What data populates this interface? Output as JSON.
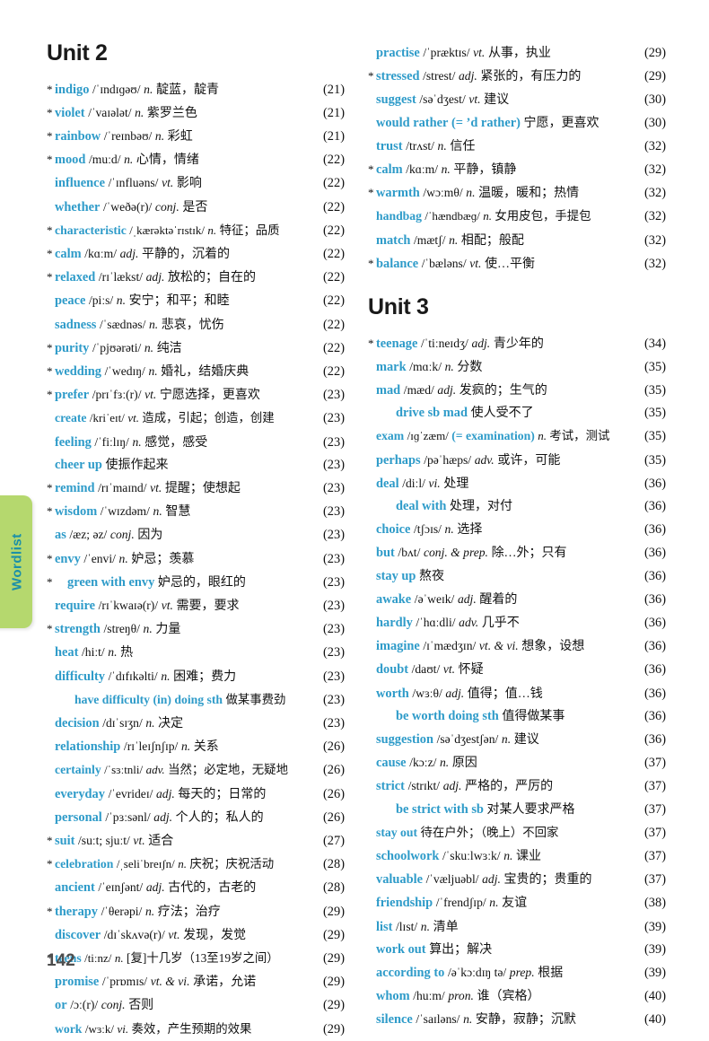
{
  "page_number": "142",
  "side_tab": {
    "label": "Wordlist",
    "bg": "#b5d86e",
    "text_color": "#1a8fa8"
  },
  "accent_color": "#2e9bc9",
  "left_column": {
    "unit_heading": "Unit 2",
    "entries": [
      {
        "star": "*",
        "word": "indigo",
        "phonetic": "/ˈɪndɪɡəʊ/",
        "pos": "n.",
        "cn": "靛蓝，靛青",
        "page": "(21)"
      },
      {
        "star": "*",
        "word": "violet",
        "phonetic": "/ˈvaɪələt/",
        "pos": "n.",
        "cn": "紫罗兰色",
        "page": "(21)"
      },
      {
        "star": "*",
        "word": "rainbow",
        "phonetic": "/ˈreɪnbəʊ/",
        "pos": "n.",
        "cn": "彩虹",
        "page": "(21)"
      },
      {
        "star": "*",
        "word": "mood",
        "phonetic": "/muːd/",
        "pos": "n.",
        "cn": "心情，情绪",
        "page": "(22)"
      },
      {
        "star": "",
        "word": "influence",
        "phonetic": "/ˈɪnfluəns/",
        "pos": "vt.",
        "cn": "影响",
        "page": "(22)"
      },
      {
        "star": "",
        "word": "whether",
        "phonetic": "/ˈweðə(r)/",
        "pos": "conj.",
        "cn": "是否",
        "page": "(22)"
      },
      {
        "star": "*",
        "word": "characteristic",
        "phonetic": "/ˌkærəktəˈrɪstɪk/",
        "pos": "n.",
        "cn": "特征；品质",
        "page": "(22)",
        "tight": true
      },
      {
        "star": "*",
        "word": "calm",
        "phonetic": "/kɑːm/",
        "pos": "adj.",
        "cn": "平静的，沉着的",
        "page": "(22)"
      },
      {
        "star": "*",
        "word": "relaxed",
        "phonetic": "/rɪˈlækst/",
        "pos": "adj.",
        "cn": "放松的；自在的",
        "page": "(22)"
      },
      {
        "star": "",
        "word": "peace",
        "phonetic": "/piːs/",
        "pos": "n.",
        "cn": "安宁；和平；和睦",
        "page": "(22)"
      },
      {
        "star": "",
        "word": "sadness",
        "phonetic": "/ˈsædnəs/",
        "pos": "n.",
        "cn": "悲哀，忧伤",
        "page": "(22)"
      },
      {
        "star": "*",
        "word": "purity",
        "phonetic": "/ˈpjʊərəti/",
        "pos": "n.",
        "cn": "纯洁",
        "page": "(22)"
      },
      {
        "star": "*",
        "word": "wedding",
        "phonetic": "/ˈwedɪŋ/",
        "pos": "n.",
        "cn": "婚礼，结婚庆典",
        "page": "(22)"
      },
      {
        "star": "*",
        "word": "prefer",
        "phonetic": "/prɪˈfɜː(r)/",
        "pos": "vt.",
        "cn": "宁愿选择，更喜欢",
        "page": "(23)"
      },
      {
        "star": "",
        "word": "create",
        "phonetic": "/kriˈeɪt/",
        "pos": "vt.",
        "cn": "造成，引起；创造，创建",
        "page": "(23)",
        "tight": true
      },
      {
        "star": "",
        "word": "feeling",
        "phonetic": "/ˈfiːlɪŋ/",
        "pos": "n.",
        "cn": "感觉，感受",
        "page": "(23)"
      },
      {
        "star": "",
        "word": "cheer up",
        "phonetic": "",
        "pos": "",
        "cn": "使振作起来",
        "page": "(23)"
      },
      {
        "star": "*",
        "word": "remind",
        "phonetic": "/rɪˈmaɪnd/",
        "pos": "vt.",
        "cn": "提醒；使想起",
        "page": "(23)"
      },
      {
        "star": "*",
        "word": "wisdom",
        "phonetic": "/ˈwɪzdəm/",
        "pos": "n.",
        "cn": "智慧",
        "page": "(23)"
      },
      {
        "star": "",
        "word": "as",
        "phonetic": "/æz; əz/",
        "pos": "conj.",
        "cn": "因为",
        "page": "(23)"
      },
      {
        "star": "*",
        "word": "envy",
        "phonetic": "/ˈenvi/",
        "pos": "n.",
        "cn": "妒忌；羡慕",
        "page": "(23)"
      },
      {
        "star": "*",
        "word": "green with envy",
        "phonetic": "",
        "pos": "",
        "cn": "妒忌的，眼红的",
        "page": "(23)",
        "indent": "sub-star"
      },
      {
        "star": "",
        "word": "require",
        "phonetic": "/rɪˈkwaɪə(r)/",
        "pos": "vt.",
        "cn": "需要，要求",
        "page": "(23)"
      },
      {
        "star": "*",
        "word": "strength",
        "phonetic": "/streŋθ/",
        "pos": "n.",
        "cn": "力量",
        "page": "(23)"
      },
      {
        "star": "",
        "word": "heat",
        "phonetic": "/hiːt/",
        "pos": "n.",
        "cn": "热",
        "page": "(23)"
      },
      {
        "star": "",
        "word": "difficulty",
        "phonetic": "/ˈdɪfɪkəlti/",
        "pos": "n.",
        "cn": "困难；费力",
        "page": "(23)"
      },
      {
        "star": "",
        "word": "have difficulty (in) doing sth",
        "phonetic": "",
        "pos": "",
        "cn": "做某事费劲",
        "page": "(23)",
        "indent": "sub",
        "tight": true
      },
      {
        "star": "",
        "word": "decision",
        "phonetic": "/dɪˈsɪʒn/",
        "pos": "n.",
        "cn": "决定",
        "page": "(23)"
      },
      {
        "star": "",
        "word": "relationship",
        "phonetic": "/rɪˈleɪʃnʃɪp/",
        "pos": "n.",
        "cn": "关系",
        "page": "(26)"
      },
      {
        "star": "",
        "word": "certainly",
        "phonetic": "/ˈsɜːtnli/",
        "pos": "adv.",
        "cn": "当然；必定地，无疑地",
        "page": "(26)",
        "tight": true
      },
      {
        "star": "",
        "word": "everyday",
        "phonetic": "/ˈevrideɪ/",
        "pos": "adj.",
        "cn": "每天的；日常的",
        "page": "(26)"
      },
      {
        "star": "",
        "word": "personal",
        "phonetic": "/ˈpɜːsənl/",
        "pos": "adj.",
        "cn": "个人的；私人的",
        "page": "(26)"
      },
      {
        "star": "*",
        "word": "suit",
        "phonetic": "/suːt; sjuːt/",
        "pos": "vt.",
        "cn": "适合",
        "page": "(27)"
      },
      {
        "star": "*",
        "word": "celebration",
        "phonetic": "/ˌseliˈbreɪʃn/",
        "pos": "n.",
        "cn": "庆祝；庆祝活动",
        "page": "(28)",
        "tight": true
      },
      {
        "star": "",
        "word": "ancient",
        "phonetic": "/ˈeɪnʃənt/",
        "pos": "adj.",
        "cn": "古代的，古老的",
        "page": "(28)"
      },
      {
        "star": "*",
        "word": "therapy",
        "phonetic": "/ˈθerəpi/",
        "pos": "n.",
        "cn": "疗法；治疗",
        "page": "(29)"
      },
      {
        "star": "",
        "word": "discover",
        "phonetic": "/dɪˈskʌvə(r)/",
        "pos": "vt.",
        "cn": "发现，发觉",
        "page": "(29)"
      },
      {
        "star": "*",
        "word": "teens",
        "phonetic": "/tiːnz/",
        "pos": "n.",
        "cn": "[复]十几岁（13至19岁之间）",
        "page": "(29)",
        "tight": true
      },
      {
        "star": "",
        "word": "promise",
        "phonetic": "/ˈprɒmɪs/",
        "pos": "vt. & vi.",
        "cn": "承诺，允诺",
        "page": "(29)"
      },
      {
        "star": "",
        "word": "or",
        "phonetic": "/ɔː(r)/",
        "pos": "conj.",
        "cn": "否则",
        "page": "(29)"
      },
      {
        "star": "",
        "word": "work",
        "phonetic": "/wɜːk/",
        "pos": "vi.",
        "cn": "奏效，产生预期的效果",
        "page": "(29)",
        "tight": true
      }
    ]
  },
  "right_column": {
    "unit2_continued": [
      {
        "star": "",
        "word": "practise",
        "phonetic": "/ˈpræktɪs/",
        "pos": "vt.",
        "cn": "从事，执业",
        "page": "(29)"
      },
      {
        "star": "*",
        "word": "stressed",
        "phonetic": "/strest/",
        "pos": "adj.",
        "cn": "紧张的，有压力的",
        "page": "(29)"
      },
      {
        "star": "",
        "word": "suggest",
        "phonetic": "/səˈdʒest/",
        "pos": "vt.",
        "cn": "建议",
        "page": "(30)"
      },
      {
        "star": "",
        "word": "would rather",
        "phonetic": "",
        "pos": "",
        "cn": "宁愿，更喜欢",
        "page": "(30)",
        "paren": "(= ’d rather)"
      },
      {
        "star": "",
        "word": "trust",
        "phonetic": "/trʌst/",
        "pos": "n.",
        "cn": "信任",
        "page": "(32)"
      },
      {
        "star": "*",
        "word": "calm",
        "phonetic": "/kɑːm/",
        "pos": "n.",
        "cn": "平静，镇静",
        "page": "(32)"
      },
      {
        "star": "*",
        "word": "warmth",
        "phonetic": "/wɔːmθ/",
        "pos": "n.",
        "cn": "温暖，暖和；热情",
        "page": "(32)"
      },
      {
        "star": "",
        "word": "handbag",
        "phonetic": "/ˈhændbæɡ/",
        "pos": "n.",
        "cn": "女用皮包，手提包",
        "page": "(32)",
        "tight": true
      },
      {
        "star": "",
        "word": "match",
        "phonetic": "/mætʃ/",
        "pos": "n.",
        "cn": "相配；般配",
        "page": "(32)"
      },
      {
        "star": "*",
        "word": "balance",
        "phonetic": "/ˈbæləns/",
        "pos": "vt.",
        "cn": "使…平衡",
        "page": "(32)"
      }
    ],
    "unit_heading": "Unit 3",
    "entries": [
      {
        "star": "*",
        "word": "teenage",
        "phonetic": "/ˈtiːneɪdʒ/",
        "pos": "adj.",
        "cn": "青少年的",
        "page": "(34)"
      },
      {
        "star": "",
        "word": "mark",
        "phonetic": "/mɑːk/",
        "pos": "n.",
        "cn": "分数",
        "page": "(35)"
      },
      {
        "star": "",
        "word": "mad",
        "phonetic": "/mæd/",
        "pos": "adj.",
        "cn": "发疯的；生气的",
        "page": "(35)"
      },
      {
        "star": "",
        "word": "drive sb mad",
        "phonetic": "",
        "pos": "",
        "cn": "使人受不了",
        "page": "(35)",
        "indent": "sub"
      },
      {
        "star": "",
        "word": "exam",
        "phonetic": "/ɪɡˈzæm/",
        "pos": "n.",
        "cn": "考试，测试",
        "page": "(35)",
        "paren": "(= examination)",
        "tight": true
      },
      {
        "star": "",
        "word": "perhaps",
        "phonetic": "/pəˈhæps/",
        "pos": "adv.",
        "cn": "或许，可能",
        "page": "(35)"
      },
      {
        "star": "",
        "word": "deal",
        "phonetic": "/diːl/",
        "pos": "vi.",
        "cn": "处理",
        "page": "(36)"
      },
      {
        "star": "",
        "word": "deal with",
        "phonetic": "",
        "pos": "",
        "cn": "处理，对付",
        "page": "(36)",
        "indent": "sub"
      },
      {
        "star": "",
        "word": "choice",
        "phonetic": "/tʃɔɪs/",
        "pos": "n.",
        "cn": "选择",
        "page": "(36)"
      },
      {
        "star": "",
        "word": "but",
        "phonetic": "/bʌt/",
        "pos": "conj. & prep.",
        "cn": "除…外；只有",
        "page": "(36)"
      },
      {
        "star": "",
        "word": "stay up",
        "phonetic": "",
        "pos": "",
        "cn": "熬夜",
        "page": "(36)"
      },
      {
        "star": "",
        "word": "awake",
        "phonetic": "/əˈweɪk/",
        "pos": "adj.",
        "cn": "醒着的",
        "page": "(36)"
      },
      {
        "star": "",
        "word": "hardly",
        "phonetic": "/ˈhɑːdli/",
        "pos": "adv.",
        "cn": "几乎不",
        "page": "(36)"
      },
      {
        "star": "",
        "word": "imagine",
        "phonetic": "/ɪˈmædʒɪn/",
        "pos": "vt. & vi.",
        "cn": "想象，设想",
        "page": "(36)"
      },
      {
        "star": "",
        "word": "doubt",
        "phonetic": "/daʊt/",
        "pos": "vt.",
        "cn": "怀疑",
        "page": "(36)"
      },
      {
        "star": "",
        "word": "worth",
        "phonetic": "/wɜːθ/",
        "pos": "adj.",
        "cn": "值得；值…钱",
        "page": "(36)"
      },
      {
        "star": "",
        "word": "be worth doing sth",
        "phonetic": "",
        "pos": "",
        "cn": "值得做某事",
        "page": "(36)",
        "indent": "sub"
      },
      {
        "star": "",
        "word": "suggestion",
        "phonetic": "/səˈdʒestʃən/",
        "pos": "n.",
        "cn": "建议",
        "page": "(36)"
      },
      {
        "star": "",
        "word": "cause",
        "phonetic": "/kɔːz/",
        "pos": "n.",
        "cn": "原因",
        "page": "(37)"
      },
      {
        "star": "",
        "word": "strict",
        "phonetic": "/strɪkt/",
        "pos": "adj.",
        "cn": "严格的，严厉的",
        "page": "(37)"
      },
      {
        "star": "",
        "word": "be strict with sb",
        "phonetic": "",
        "pos": "",
        "cn": "对某人要求严格",
        "page": "(37)",
        "indent": "sub"
      },
      {
        "star": "",
        "word": "stay out",
        "phonetic": "",
        "pos": "",
        "cn": "待在户外；（晚上）不回家",
        "page": "(37)",
        "tight": true
      },
      {
        "star": "",
        "word": "schoolwork",
        "phonetic": "/ˈskuːlwɜːk/",
        "pos": "n.",
        "cn": "课业",
        "page": "(37)"
      },
      {
        "star": "",
        "word": "valuable",
        "phonetic": "/ˈvæljuəbl/",
        "pos": "adj.",
        "cn": "宝贵的；贵重的",
        "page": "(37)"
      },
      {
        "star": "",
        "word": "friendship",
        "phonetic": "/ˈfrendʃɪp/",
        "pos": "n.",
        "cn": "友谊",
        "page": "(38)"
      },
      {
        "star": "",
        "word": "list",
        "phonetic": "/lɪst/",
        "pos": "n.",
        "cn": "清单",
        "page": "(39)"
      },
      {
        "star": "",
        "word": "work out",
        "phonetic": "",
        "pos": "",
        "cn": "算出；解决",
        "page": "(39)"
      },
      {
        "star": "",
        "word": "according to",
        "phonetic": "/əˈkɔːdɪŋ tə/",
        "pos": "prep.",
        "cn": "根据",
        "page": "(39)"
      },
      {
        "star": "",
        "word": "whom",
        "phonetic": "/huːm/",
        "pos": "pron.",
        "cn": "谁（宾格）",
        "page": "(40)"
      },
      {
        "star": "",
        "word": "silence",
        "phonetic": "/ˈsaɪləns/",
        "pos": "n.",
        "cn": "安静，寂静；沉默",
        "page": "(40)"
      }
    ]
  }
}
